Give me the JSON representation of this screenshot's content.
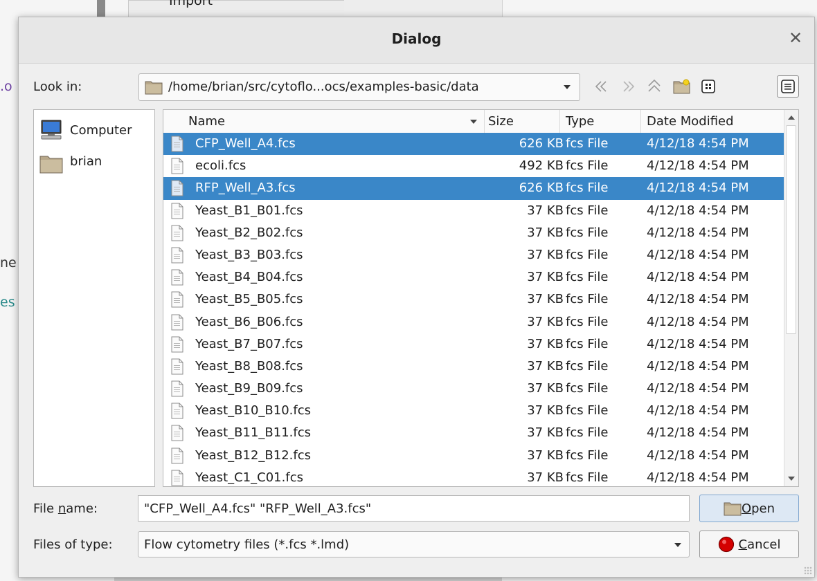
{
  "background": {
    "menu_fragment": "Import",
    "side_fragments": [
      ".o",
      "ne",
      "es"
    ],
    "fragment_colors": [
      "#6b3fa0",
      "#333333",
      "#2a8a8a"
    ]
  },
  "dialog": {
    "title": "Dialog",
    "close_icon": "close-icon",
    "look_in": {
      "label": "Look in:",
      "path": "/home/brian/src/cytoflo...ocs/examples-basic/data"
    },
    "toolbar": [
      "back-icon",
      "forward-icon",
      "parent-directory-icon",
      "new-folder-icon",
      "detail-view-icon",
      "list-view-icon"
    ],
    "sidebar": {
      "items": [
        {
          "label": "Computer",
          "icon": "computer-icon"
        },
        {
          "label": "brian",
          "icon": "folder-icon"
        }
      ]
    },
    "file_list": {
      "columns": [
        "Name",
        "Size",
        "Type",
        "Date Modified"
      ],
      "sort_column": "Name",
      "rows": [
        {
          "name": "CFP_Well_A4.fcs",
          "size": "626 KB",
          "type": "fcs File",
          "date": "4/12/18 4:54 PM",
          "selected": true
        },
        {
          "name": "ecoli.fcs",
          "size": "492 KB",
          "type": "fcs File",
          "date": "4/12/18 4:54 PM",
          "selected": false
        },
        {
          "name": "RFP_Well_A3.fcs",
          "size": "626 KB",
          "type": "fcs File",
          "date": "4/12/18 4:54 PM",
          "selected": true
        },
        {
          "name": "Yeast_B1_B01.fcs",
          "size": "37 KB",
          "type": "fcs File",
          "date": "4/12/18 4:54 PM",
          "selected": false
        },
        {
          "name": "Yeast_B2_B02.fcs",
          "size": "37 KB",
          "type": "fcs File",
          "date": "4/12/18 4:54 PM",
          "selected": false
        },
        {
          "name": "Yeast_B3_B03.fcs",
          "size": "37 KB",
          "type": "fcs File",
          "date": "4/12/18 4:54 PM",
          "selected": false
        },
        {
          "name": "Yeast_B4_B04.fcs",
          "size": "37 KB",
          "type": "fcs File",
          "date": "4/12/18 4:54 PM",
          "selected": false
        },
        {
          "name": "Yeast_B5_B05.fcs",
          "size": "37 KB",
          "type": "fcs File",
          "date": "4/12/18 4:54 PM",
          "selected": false
        },
        {
          "name": "Yeast_B6_B06.fcs",
          "size": "37 KB",
          "type": "fcs File",
          "date": "4/12/18 4:54 PM",
          "selected": false
        },
        {
          "name": "Yeast_B7_B07.fcs",
          "size": "37 KB",
          "type": "fcs File",
          "date": "4/12/18 4:54 PM",
          "selected": false
        },
        {
          "name": "Yeast_B8_B08.fcs",
          "size": "37 KB",
          "type": "fcs File",
          "date": "4/12/18 4:54 PM",
          "selected": false
        },
        {
          "name": "Yeast_B9_B09.fcs",
          "size": "37 KB",
          "type": "fcs File",
          "date": "4/12/18 4:54 PM",
          "selected": false
        },
        {
          "name": "Yeast_B10_B10.fcs",
          "size": "37 KB",
          "type": "fcs File",
          "date": "4/12/18 4:54 PM",
          "selected": false
        },
        {
          "name": "Yeast_B11_B11.fcs",
          "size": "37 KB",
          "type": "fcs File",
          "date": "4/12/18 4:54 PM",
          "selected": false
        },
        {
          "name": "Yeast_B12_B12.fcs",
          "size": "37 KB",
          "type": "fcs File",
          "date": "4/12/18 4:54 PM",
          "selected": false
        },
        {
          "name": "Yeast_C1_C01.fcs",
          "size": "37 KB",
          "type": "fcs File",
          "date": "4/12/18 4:54 PM",
          "selected": false
        }
      ]
    },
    "file_name": {
      "label_pre": "File ",
      "label_accel": "n",
      "label_post": "ame:",
      "value": "\"CFP_Well_A4.fcs\" \"RFP_Well_A3.fcs\""
    },
    "files_of_type": {
      "label": "Files of type:",
      "value": "Flow cytometry files (*.fcs *.lmd)"
    },
    "open_button": {
      "accel": "O",
      "rest": "pen",
      "icon": "folder-icon"
    },
    "cancel_button": {
      "accel": "C",
      "rest": "ancel",
      "icon": "stop-icon"
    },
    "colors": {
      "selection": "#3a87c8",
      "cancel_icon": "#d40000",
      "folder": "#b8a88a"
    }
  }
}
